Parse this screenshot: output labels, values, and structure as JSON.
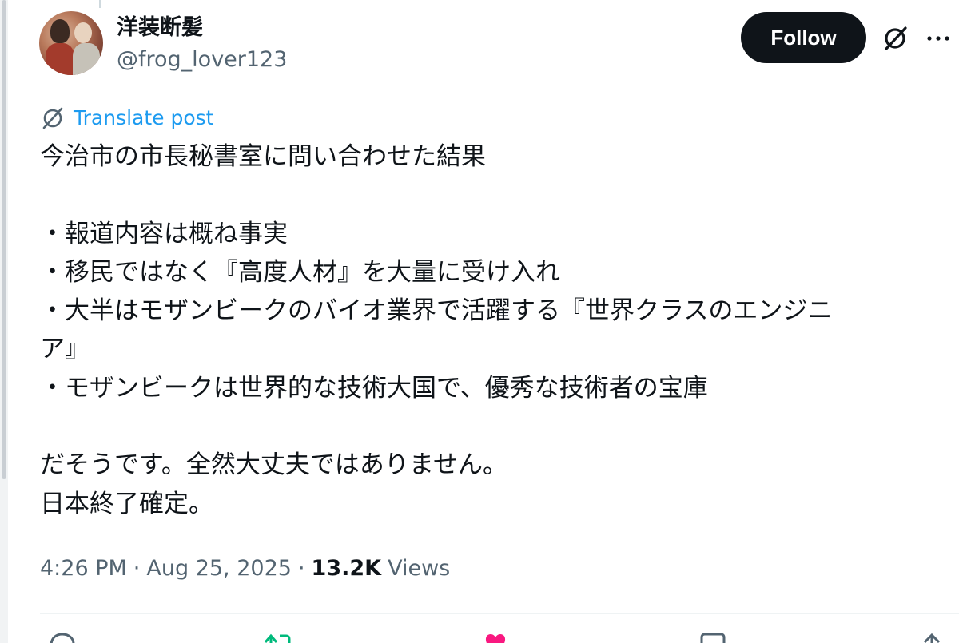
{
  "author": {
    "display_name": "洋装断髪",
    "handle": "@frog_lover123"
  },
  "header": {
    "follow_label": "Follow",
    "grok_icon": "grok-icon",
    "more_icon": "more-icon"
  },
  "translate": {
    "label": "Translate post",
    "icon": "translate-icon"
  },
  "post": {
    "lines": [
      "今治市の市長秘書室に問い合わせた結果",
      "",
      "・報道内容は概ね事実",
      "・移民ではなく『高度人材』を大量に受け入れ",
      "・大半はモザンビークのバイオ業界で活躍する『世界クラスのエンジニ",
      "ア』",
      "・モザンビークは世界的な技術大国で、優秀な技術者の宝庫",
      "",
      "だそうです。全然大丈夫ではありません。",
      "日本終了確定。"
    ]
  },
  "meta": {
    "time": "4:26 PM",
    "date": "Aug 25, 2025",
    "separator": "·",
    "views_count": "13.2K",
    "views_label": "Views"
  },
  "actions": [
    {
      "name": "reply-icon",
      "color": "#536471"
    },
    {
      "name": "repost-icon",
      "color": "#00ba7c"
    },
    {
      "name": "like-icon",
      "color": "#f91880"
    },
    {
      "name": "bookmark-icon",
      "color": "#536471"
    },
    {
      "name": "share-icon",
      "color": "#536471"
    }
  ]
}
